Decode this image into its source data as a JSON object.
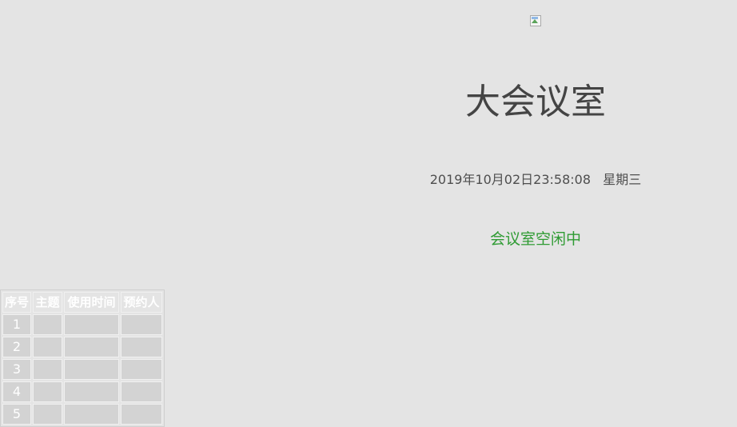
{
  "room": {
    "name": "大会议室"
  },
  "datetime": {
    "text": "2019年10月02日23:58:08   星期三"
  },
  "status": {
    "text": "会议室空闲中",
    "color": "#2f9b33"
  },
  "schedule": {
    "headers": [
      "序号",
      "主题",
      "使用时间",
      "预约人"
    ],
    "rows": [
      {
        "no": "1",
        "topic": "",
        "time": "",
        "person": ""
      },
      {
        "no": "2",
        "topic": "",
        "time": "",
        "person": ""
      },
      {
        "no": "3",
        "topic": "",
        "time": "",
        "person": ""
      },
      {
        "no": "4",
        "topic": "",
        "time": "",
        "person": ""
      },
      {
        "no": "5",
        "topic": "",
        "time": "",
        "person": ""
      }
    ]
  },
  "colors": {
    "background": "#e4e4e4",
    "cell": "#d3d3d3",
    "text": "#444444"
  }
}
